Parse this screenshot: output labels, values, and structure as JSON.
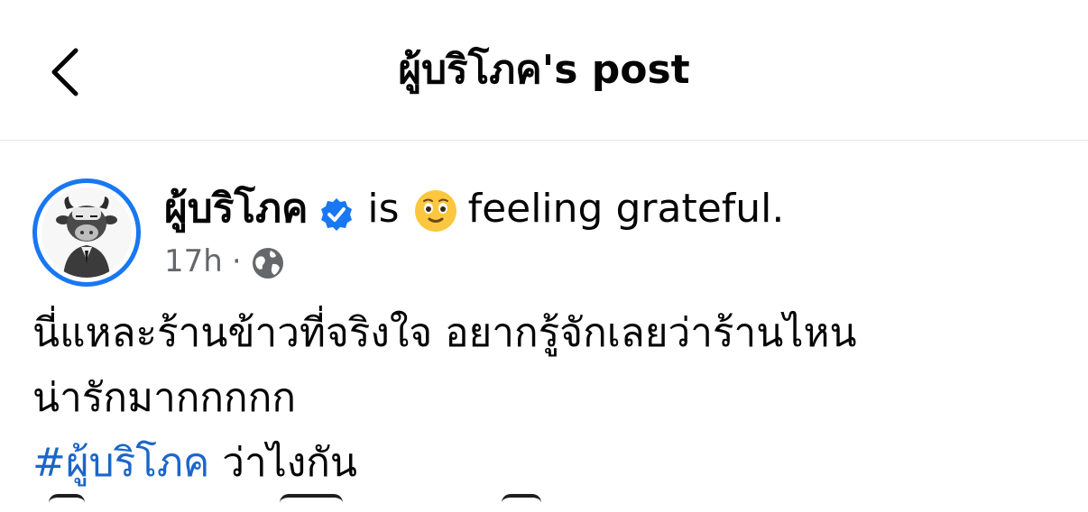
{
  "header": {
    "title": "ผู้บริโภค's post",
    "back_icon": "chevron-left-icon"
  },
  "post": {
    "author": "ผู้บริโภค",
    "verified_icon": "verified-badge-icon",
    "verified_color": "#1877f2",
    "feeling_prefix": "is",
    "feeling_icon": "grateful-face-emoji",
    "feeling_text": "feeling grateful.",
    "time": "17h",
    "dot": "·",
    "audience_icon": "globe-icon",
    "text_lines": [
      "นี่แหละร้านข้าวที่จริงใจ อยากรู้จักเลยว่าร้านไหน",
      "น่ารักมากกกกก"
    ],
    "hashtag": "#ผู้บริโภค",
    "hashtag_suffix": " ว่าไงกัน",
    "hashtag_color": "#1b66c9"
  },
  "colors": {
    "text": "#050505",
    "meta": "#65676b",
    "divider": "#e4e6eb"
  }
}
